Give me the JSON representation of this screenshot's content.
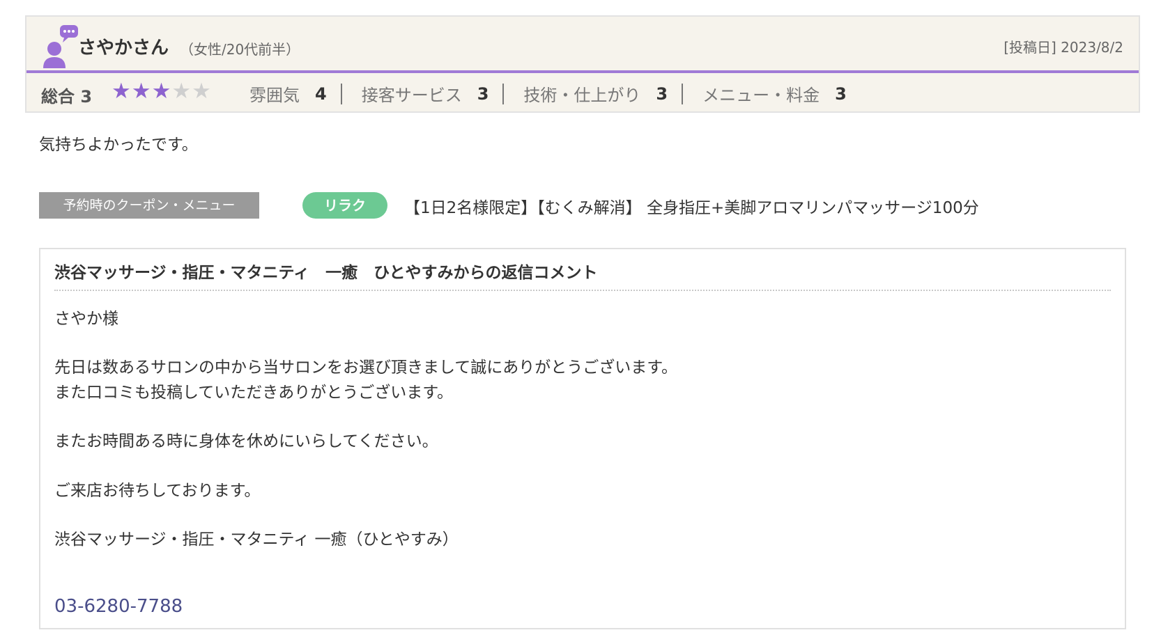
{
  "review": {
    "reviewer_name": "さやかさん",
    "reviewer_demographic": "（女性/20代前半）",
    "post_date": "[投稿日] 2023/8/2",
    "icon": "reviewer-avatar-icon",
    "overall_label": "総合 3",
    "overall_score": 3,
    "stars_max": 5,
    "star_on": "★★★",
    "star_off": "★★",
    "sub_ratings": [
      {
        "label": "雰囲気",
        "score": "4"
      },
      {
        "label": "接客サービス",
        "score": "3"
      },
      {
        "label": "技術・仕上がり",
        "score": "3"
      },
      {
        "label": "メニュー・料金",
        "score": "3"
      }
    ],
    "body": "気持ちよかったです。"
  },
  "coupon": {
    "label": "予約時のクーポン・メニュー",
    "badge": "リラク",
    "text": "【1日2名様限定】【むくみ解消】 全身指圧+美脚アロマリンパマッサージ100分"
  },
  "reply": {
    "title": "渋谷マッサージ・指圧・マタニティ　一癒　ひとやすみからの返信コメント",
    "lines": [
      "さやか様",
      "先日は数あるサロンの中から当サロンをお選び頂きまして誠にありがとうございます。",
      "また口コミも投稿していただきありがとうございます。",
      "またお時間ある時に身体を休めにいらしてください。",
      "ご来店お待ちしております。",
      "渋谷マッサージ・指圧・マタニティ 一癒（ひとやすみ）"
    ],
    "phone": "03-6280-7788"
  },
  "colors": {
    "accent_purple": "#a07ad6",
    "star_purple": "#8d63cf",
    "badge_green": "#6cc993",
    "phone_link": "#4a4e8a"
  }
}
